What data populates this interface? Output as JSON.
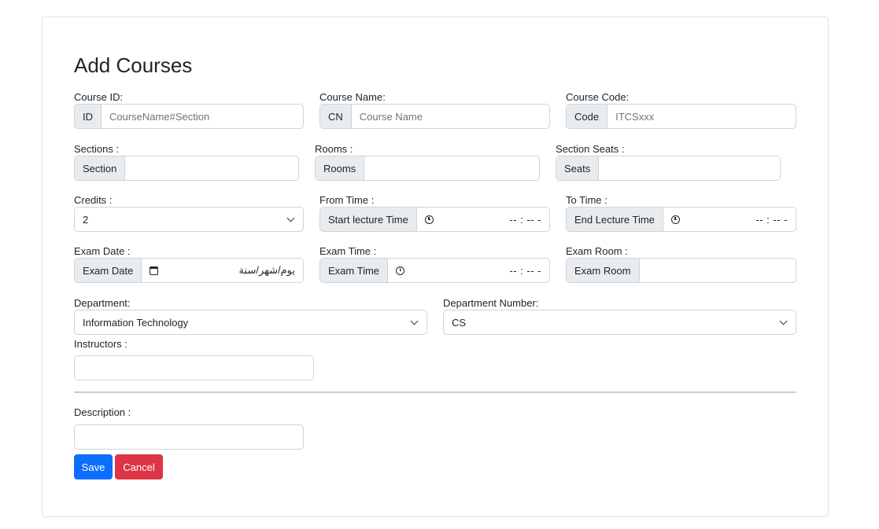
{
  "form": {
    "title": "Add Courses",
    "course_id": {
      "label": "Course ID:",
      "addon": "ID",
      "placeholder": "CourseName#Section"
    },
    "course_name": {
      "label": "Course Name:",
      "addon": "CN",
      "placeholder": "Course Name"
    },
    "course_code": {
      "label": "Course Code:",
      "addon": "Code",
      "placeholder": "ITCSxxx"
    },
    "sections": {
      "label": "Sections :",
      "addon": "Section"
    },
    "rooms": {
      "label": "Rooms :",
      "addon": "Rooms"
    },
    "section_seats": {
      "label": "Section Seats :",
      "addon": "Seats"
    },
    "credits": {
      "label": "Credits :",
      "value": "2"
    },
    "from_time": {
      "label": "From Time :",
      "addon": "Start lecture Time",
      "value": "-- : -- -"
    },
    "to_time": {
      "label": "To Time :",
      "addon": "End Lecture Time",
      "value": "-- : -- -"
    },
    "exam_date": {
      "label": "Exam Date :",
      "addon": "Exam Date",
      "value": "يوم/شهر/سنة"
    },
    "exam_time": {
      "label": "Exam Time :",
      "addon": "Exam Time",
      "value": "-- : -- -"
    },
    "exam_room": {
      "label": "Exam Room :",
      "addon": "Exam Room"
    },
    "department": {
      "label": "Department:",
      "value": "Information Technology"
    },
    "department_number": {
      "label": "Department Number:",
      "value": "CS"
    },
    "instructors": {
      "label": "Instructors :"
    },
    "description": {
      "label": "Description :"
    },
    "save_label": "Save",
    "cancel_label": "Cancel"
  },
  "colors": {
    "primary": "#0d6efd",
    "danger": "#dc3545",
    "addon_bg": "#e9ecef",
    "border": "#ced4da"
  },
  "icons": {
    "time": "clock-icon",
    "date": "calendar-icon",
    "select": "chevron-down-icon"
  }
}
